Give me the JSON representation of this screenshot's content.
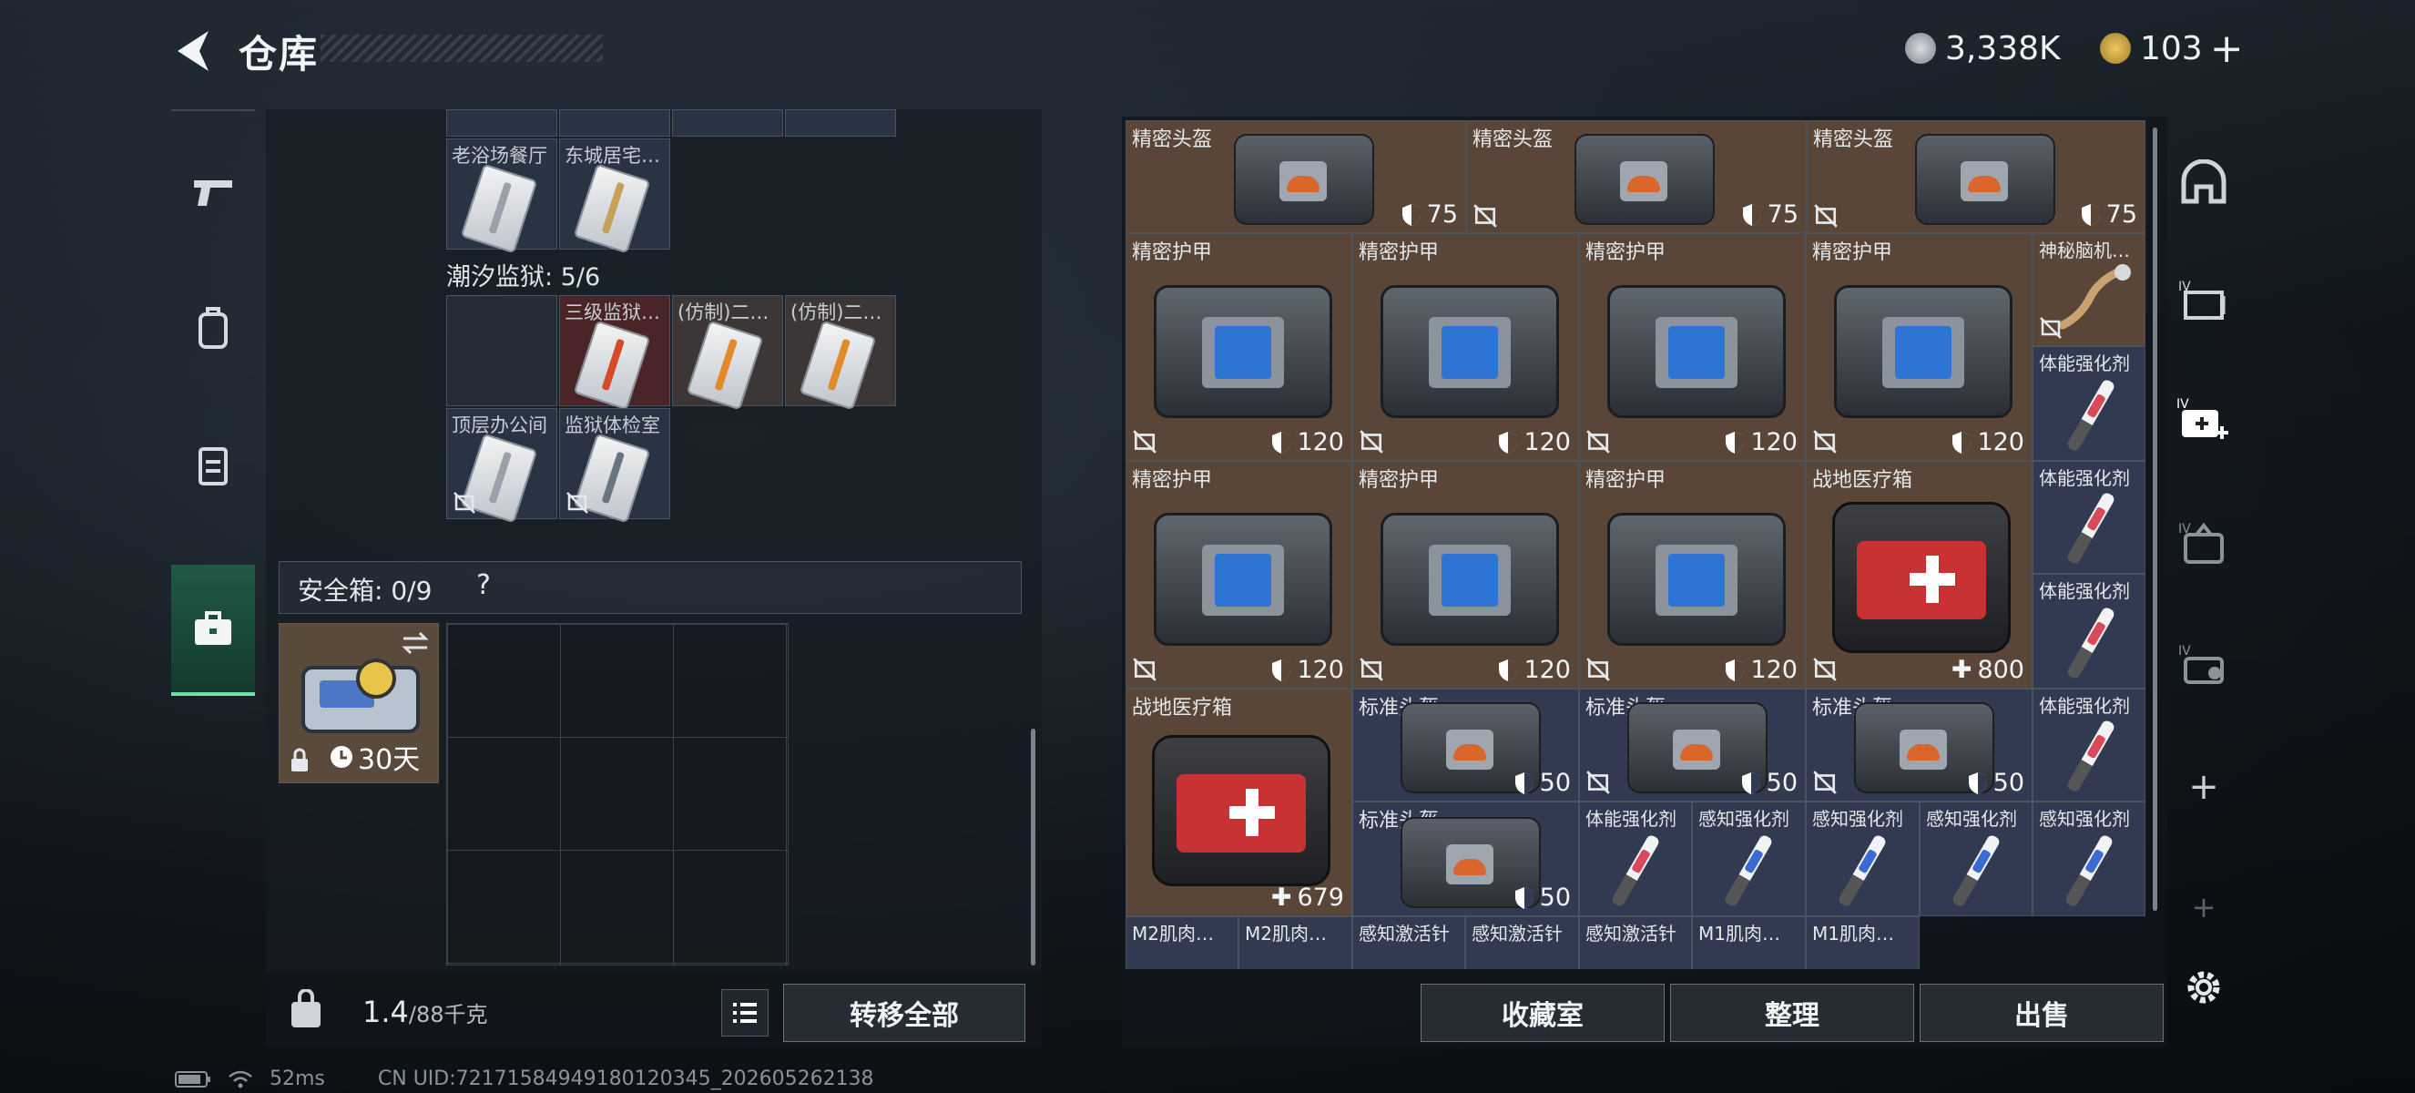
{
  "header": {
    "title": "仓库"
  },
  "currency": {
    "coins": "3,338K",
    "tickets": "103"
  },
  "left_panel": {
    "row_top_labels": [
      "老浴场餐厅",
      "东城居宅…"
    ],
    "prison_section": "潮汐监狱: 5/6",
    "prison_items": [
      "三级监狱…",
      "(仿制)二…",
      "(仿制)二…",
      "顶层办公间",
      "监狱体检室"
    ]
  },
  "safebox": {
    "label": "安全箱: 0/9",
    "help": "?",
    "duration": "30天"
  },
  "weight": {
    "current": "1.4",
    "capacity": "/88千克"
  },
  "buttons": {
    "transfer_all": "转移全部",
    "collection": "收藏室",
    "organize": "整理",
    "sell": "出售"
  },
  "status": {
    "ping": "52ms",
    "uid": "CN UID:72171584949180120345_202605262138"
  },
  "grid": {
    "helmets_top": [
      {
        "name": "精密头盔",
        "value": "75"
      },
      {
        "name": "精密头盔",
        "value": "75"
      },
      {
        "name": "精密头盔",
        "value": "75"
      }
    ],
    "armors_row1": [
      {
        "name": "精密护甲",
        "value": "120"
      },
      {
        "name": "精密护甲",
        "value": "120"
      },
      {
        "name": "精密护甲",
        "value": "120"
      },
      {
        "name": "精密护甲",
        "value": "120"
      }
    ],
    "armors_row2": [
      {
        "name": "精密护甲",
        "value": "120"
      },
      {
        "name": "精密护甲",
        "value": "120"
      },
      {
        "name": "精密护甲",
        "value": "120"
      }
    ],
    "brain_chip": {
      "name": "神秘脑机…"
    },
    "medkit1": {
      "name": "战地医疗箱",
      "value": "800"
    },
    "medkit2": {
      "name": "战地医疗箱",
      "value": "679"
    },
    "std_helmets": [
      {
        "name": "标准头盔",
        "value": "50"
      },
      {
        "name": "标准头盔",
        "value": "50"
      },
      {
        "name": "标准头盔",
        "value": "50"
      },
      {
        "name": "标准头盔",
        "value": "50"
      }
    ],
    "side_syringes": [
      "体能强化剂",
      "体能强化剂",
      "体能强化剂",
      "体能强化剂"
    ],
    "row5_syringes": [
      "体能强化剂",
      "感知强化剂",
      "感知强化剂",
      "感知强化剂",
      "感知强化剂"
    ],
    "row6_labels": [
      "M2肌肉…",
      "M2肌肉…",
      "感知激活针",
      "感知激活针",
      "感知激活针",
      "M1肌肉…",
      "M1肌肉…"
    ]
  },
  "colors": {
    "accent_green": "#6fe0a8",
    "brown_cell": "#5a4638",
    "blue_cell": "#323a52",
    "red_cell": "#4a2427"
  }
}
